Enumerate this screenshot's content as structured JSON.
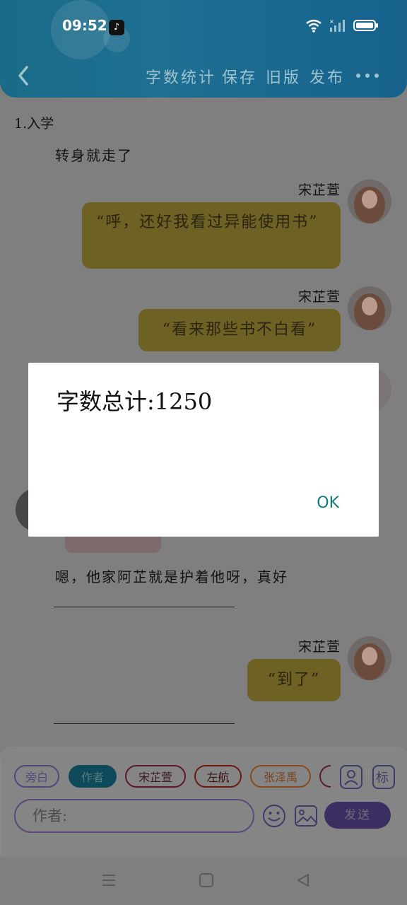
{
  "status": {
    "time": "09:52"
  },
  "toolbar": {
    "word_count": "字数统计",
    "save": "保存",
    "old_version": "旧版",
    "publish": "发布"
  },
  "story": {
    "chapter": "1.入学",
    "narration_top": "转身就走了",
    "msg1": {
      "speaker": "宋芷萱",
      "text": "“呼，还好我看过异能使用书”"
    },
    "msg2": {
      "speaker": "宋芷萱",
      "text": "“看来那些书不白看”"
    },
    "narration_mid": "嗯，他家阿芷就是护着他呀，真好",
    "msg3": {
      "speaker": "宋芷萱",
      "text": "“到了”"
    }
  },
  "roles": [
    "旁白",
    "作者",
    "宋芷萱",
    "左航",
    "张泽禹"
  ],
  "input": {
    "placeholder": "作者:"
  },
  "send_label": "发送",
  "dialog": {
    "message": "字数总计:1250",
    "ok": "OK"
  },
  "colors": {
    "header": "#1a6b87",
    "dialog_ok": "#137b80",
    "bubble": "#6d6124"
  }
}
